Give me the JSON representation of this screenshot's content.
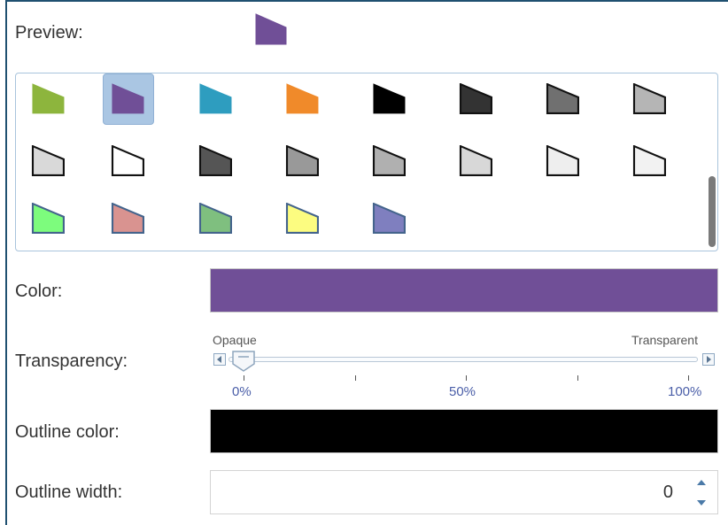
{
  "labels": {
    "preview": "Preview:",
    "color": "Color:",
    "transparency": "Transparency:",
    "outline_color": "Outline color:",
    "outline_width": "Outline width:"
  },
  "preview": {
    "fill": "#704f97",
    "outline": "#704f97"
  },
  "symbols": [
    {
      "fill": "#8db53d",
      "outline": "#8db53d",
      "selected": false
    },
    {
      "fill": "#704f97",
      "outline": "#704f97",
      "selected": true
    },
    {
      "fill": "#2e9dbf",
      "outline": "#2e9dbf",
      "selected": false
    },
    {
      "fill": "#f08a2a",
      "outline": "#f08a2a",
      "selected": false
    },
    {
      "fill": "#000000",
      "outline": "#000000",
      "selected": false
    },
    {
      "fill": "#333333",
      "outline": "#111111",
      "selected": false
    },
    {
      "fill": "#707070",
      "outline": "#111111",
      "selected": false
    },
    {
      "fill": "#b5b5b5",
      "outline": "#111111",
      "selected": false
    },
    {
      "fill": "#d9d9d9",
      "outline": "#111111",
      "selected": false
    },
    {
      "fill": "#ffffff",
      "outline": "#111111",
      "selected": false
    },
    {
      "fill": "#555555",
      "outline": "#111111",
      "selected": false
    },
    {
      "fill": "#999999",
      "outline": "#111111",
      "selected": false
    },
    {
      "fill": "#b0b0b0",
      "outline": "#111111",
      "selected": false
    },
    {
      "fill": "#d8d8d8",
      "outline": "#111111",
      "selected": false
    },
    {
      "fill": "#eeeeee",
      "outline": "#111111",
      "selected": false
    },
    {
      "fill": "#f2f2f2",
      "outline": "#111111",
      "selected": false
    },
    {
      "fill": "#7dfc7d",
      "outline": "#44648c",
      "selected": false
    },
    {
      "fill": "#d99390",
      "outline": "#44648c",
      "selected": false
    },
    {
      "fill": "#7fbf7f",
      "outline": "#44648c",
      "selected": false
    },
    {
      "fill": "#fcfc80",
      "outline": "#44648c",
      "selected": false
    },
    {
      "fill": "#7f7fbf",
      "outline": "#44648c",
      "selected": false
    }
  ],
  "color": {
    "value": "#704f97"
  },
  "transparency": {
    "min_label": "Opaque",
    "max_label": "Transparent",
    "value_percent": 0,
    "ticks": [
      "0%",
      "50%",
      "100%"
    ]
  },
  "outline_color": {
    "value": "#000000"
  },
  "outline_width": {
    "value": "0"
  },
  "icons": {
    "slider_left": "triangle-left-icon",
    "slider_right": "triangle-right-icon",
    "spin_up": "chevron-up-icon",
    "spin_down": "chevron-down-icon"
  }
}
